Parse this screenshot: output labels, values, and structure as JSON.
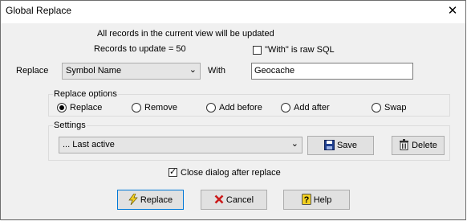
{
  "window": {
    "title": "Global Replace",
    "close_glyph": "✕"
  },
  "info": {
    "line1": "All records in the current view will be updated",
    "records": "Records to update = 50"
  },
  "raw_sql": {
    "label": "\"With\" is raw SQL",
    "checked": false
  },
  "replace": {
    "label": "Replace",
    "field_value": "Symbol Name",
    "with_label": "With",
    "with_value": "Geocache"
  },
  "options": {
    "title": "Replace options",
    "items": [
      "Replace",
      "Remove",
      "Add before",
      "Add after",
      "Swap"
    ],
    "selected": "Replace"
  },
  "settings": {
    "title": "Settings",
    "combo_value": "... Last active",
    "save_label": "Save",
    "delete_label": "Delete"
  },
  "close_after": {
    "label": "Close dialog after replace",
    "checked": true
  },
  "buttons": {
    "replace": "Replace",
    "cancel": "Cancel",
    "help": "Help"
  },
  "icons": {
    "combo_arrow": "chevron-down-icon",
    "save": "floppy-disk-icon",
    "delete": "trash-can-icon",
    "replace": "lightning-icon",
    "cancel": "red-x-icon",
    "help": "question-mark-icon"
  },
  "colors": {
    "accent": "#0078d7",
    "cancel_red": "#cc1a1a",
    "save_blue": "#1f3f8f"
  }
}
